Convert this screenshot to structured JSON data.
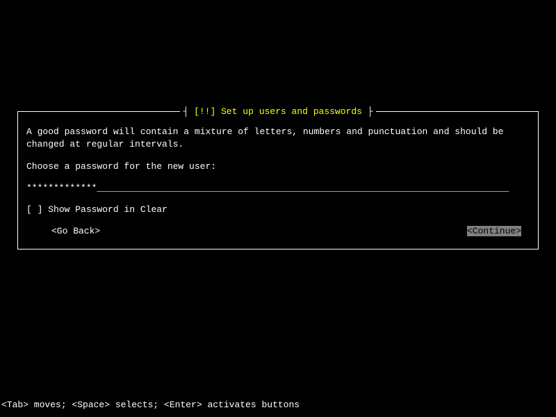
{
  "dialog": {
    "title_priority": "[!!]",
    "title_text": "Set up users and passwords",
    "description": "A good password will contain a mixture of letters, numbers and punctuation and should be changed at regular intervals.",
    "prompt": "Choose a password for the new user:",
    "password_masked": "*************",
    "checkbox_state": "[ ]",
    "checkbox_label": "Show Password in Clear",
    "go_back_label": "<Go Back>",
    "continue_label": "<Continue>"
  },
  "footer": {
    "help_text": "<Tab> moves; <Space> selects; <Enter> activates buttons"
  }
}
